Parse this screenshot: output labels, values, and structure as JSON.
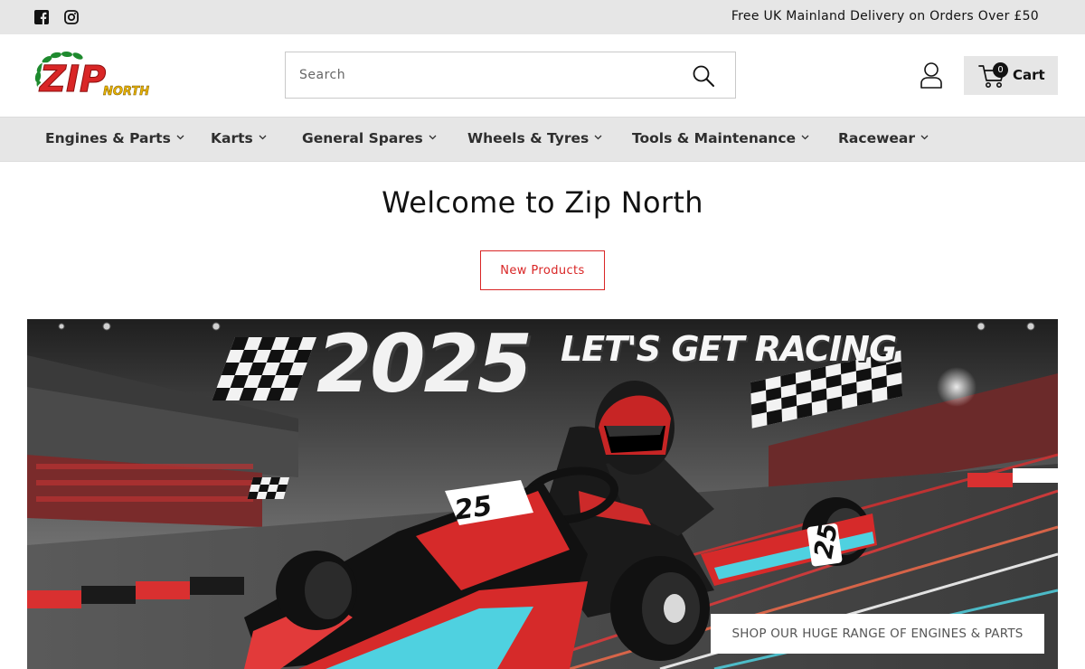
{
  "announcement": {
    "text": "Free UK Mainland Delivery on Orders Over £50"
  },
  "social": [
    {
      "icon": "facebook-icon"
    },
    {
      "icon": "instagram-icon"
    }
  ],
  "header": {
    "logo": {
      "main": "ZIP",
      "sub": "NORTH"
    },
    "search": {
      "placeholder": "Search",
      "value": ""
    },
    "cart": {
      "count": "0",
      "label": "Cart"
    }
  },
  "nav": {
    "items": [
      {
        "label": "Engines & Parts"
      },
      {
        "label": "Karts"
      },
      {
        "label": "General Spares"
      },
      {
        "label": "Wheels & Tyres"
      },
      {
        "label": "Tools & Maintenance"
      },
      {
        "label": "Racewear"
      }
    ]
  },
  "main": {
    "title": "Welcome to Zip North",
    "new_products_label": "New Products"
  },
  "banner": {
    "year": "2025",
    "slogan": "LET'S GET RACING",
    "kart_number": "25",
    "cta_label": "SHOP OUR HUGE RANGE OF ENGINES & PARTS"
  },
  "colors": {
    "accent": "#d92626",
    "topbar_bg": "#e6e6e6",
    "text": "#121212"
  }
}
